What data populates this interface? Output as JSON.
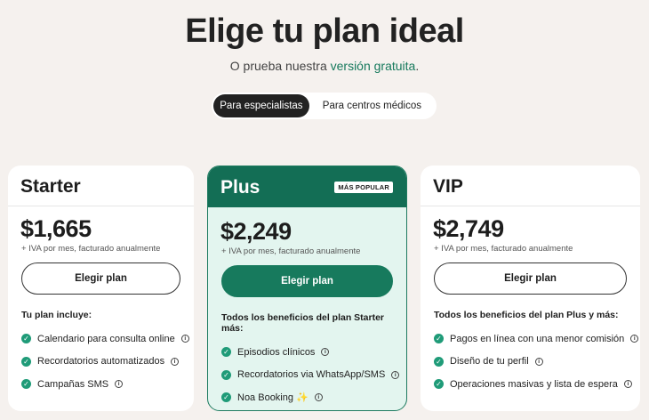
{
  "header": {
    "title": "Elige tu plan ideal",
    "subtitle_prefix": "O prueba nuestra ",
    "subtitle_link": "versión gratuita",
    "subtitle_suffix": "."
  },
  "toggle": {
    "options": [
      "Para especialistas",
      "Para centros médicos"
    ],
    "selected": "Para especialistas"
  },
  "plans": [
    {
      "name": "Starter",
      "price": "$1,665",
      "price_note": "+ IVA por mes, facturado anualmente",
      "button": "Elegir plan",
      "includes": "Tu plan incluye:",
      "features": [
        "Calendario para consulta online",
        "Recordatorios automatizados",
        "Campañas SMS"
      ]
    },
    {
      "name": "Plus",
      "badge": "MÁS POPULAR",
      "price": "$2,249",
      "price_note": "+ IVA por mes, facturado anualmente",
      "button": "Elegir plan",
      "includes": "Todos los beneficios del plan Starter más:",
      "features": [
        "Episodios clínicos",
        "Recordatorios via WhatsApp/SMS",
        "Noa Booking ✨"
      ]
    },
    {
      "name": "VIP",
      "price": "$2,749",
      "price_note": "+ IVA por mes, facturado anualmente",
      "button": "Elegir plan",
      "includes": "Todos los beneficios del plan Plus y más:",
      "features": [
        "Pagos en línea con una menor comisión",
        "Diseño de tu perfil",
        "Operaciones masivas y lista de espera"
      ]
    }
  ],
  "colors": {
    "accent": "#177a5d",
    "background": "#f5f1ee",
    "check": "#1f9b78"
  },
  "icons": {
    "check": "check-circle-icon",
    "info": "info-icon"
  }
}
